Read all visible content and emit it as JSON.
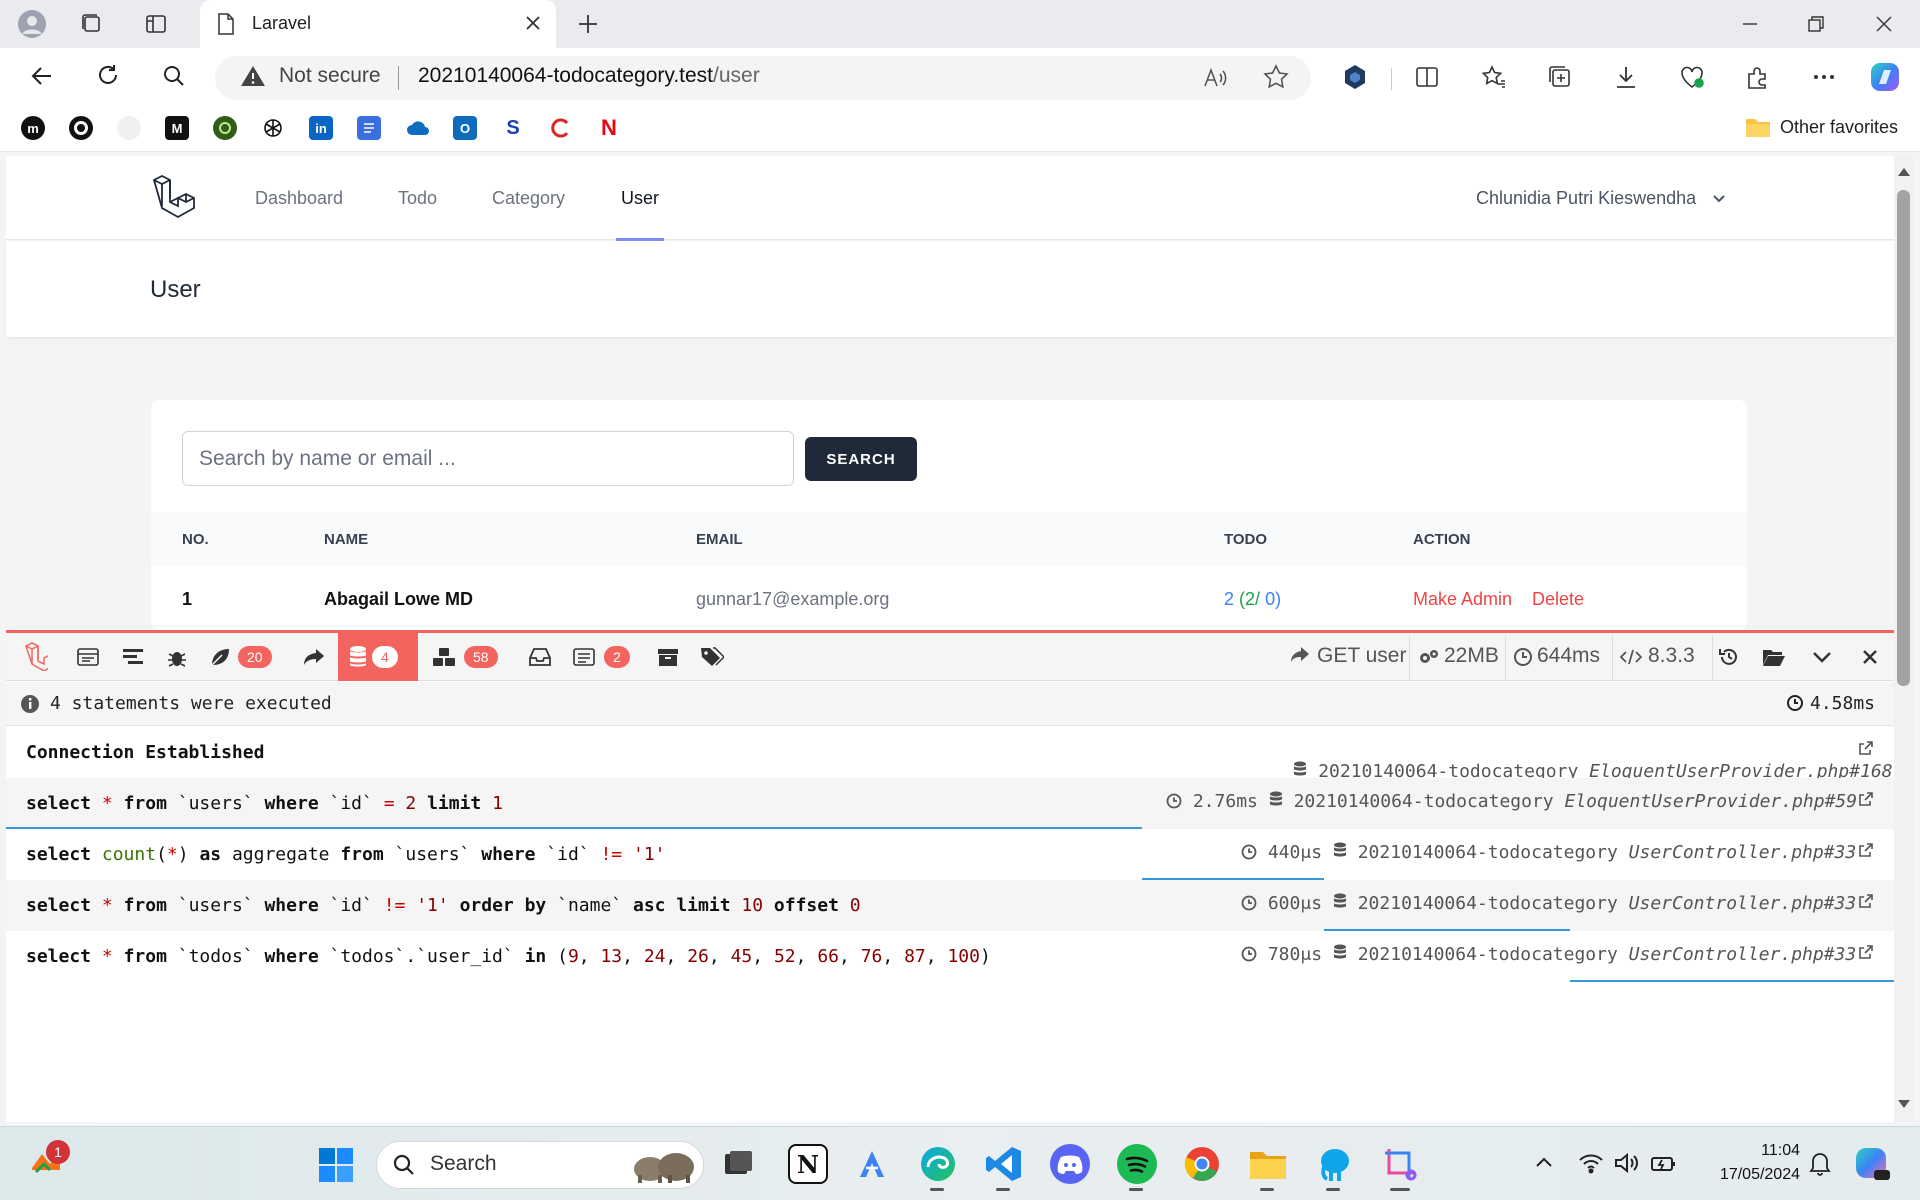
{
  "browser": {
    "tab_title": "Laravel",
    "not_secure": "Not secure",
    "url_host": "20210140064-todocategory.test",
    "url_path": "/user",
    "other_favorites": "Other favorites"
  },
  "nav": {
    "links": [
      "Dashboard",
      "Todo",
      "Category",
      "User"
    ],
    "active": "User",
    "account_name": "Chlunidia Putri Kieswendha"
  },
  "header": {
    "title": "User"
  },
  "search": {
    "placeholder": "Search by name or email ...",
    "button": "SEARCH"
  },
  "table": {
    "columns": [
      "NO.",
      "NAME",
      "EMAIL",
      "TODO",
      "ACTION"
    ],
    "rows": [
      {
        "no": "1",
        "name": "Abagail Lowe MD",
        "email": "gunnar17@example.org",
        "todo_total": "2",
        "todo_open": "(2/",
        "todo_done": "0)",
        "make_admin": "Make Admin",
        "delete": "Delete"
      }
    ]
  },
  "debugbar": {
    "badges": {
      "views": "20",
      "queries": "4",
      "models": "58",
      "gates": "2"
    },
    "request": "GET user",
    "memory": "22MB",
    "duration": "644ms",
    "php_version": "8.3.3",
    "summary": "4 statements were executed",
    "total_time": "4.58ms",
    "connection_label": "Connection Established",
    "connection_meta": "20210140064-todocategory",
    "connection_source": "EloquentUserProvider.php#168",
    "queries": [
      {
        "time": "2.76ms",
        "db": "20210140064-todocategory",
        "source": "EloquentUserProvider.php#59"
      },
      {
        "time": "440μs",
        "db": "20210140064-todocategory",
        "source": "UserController.php#33"
      },
      {
        "time": "600μs",
        "db": "20210140064-todocategory",
        "source": "UserController.php#33"
      },
      {
        "time": "780μs",
        "db": "20210140064-todocategory",
        "source": "UserController.php#33"
      }
    ]
  },
  "taskbar": {
    "search_label": "Search",
    "notification_count": "1",
    "time": "11:04",
    "date": "17/05/2024"
  },
  "colors": {
    "accent": "#818cf8",
    "debugbar": "#f4645f",
    "danger": "#ef4444",
    "success": "#16a34a"
  }
}
